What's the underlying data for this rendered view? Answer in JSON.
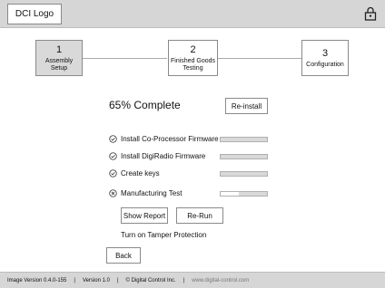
{
  "header": {
    "logo_label": "DCI Logo",
    "lock_icon": "lock-icon"
  },
  "steps": [
    {
      "number": "1",
      "label": "Assembly Setup",
      "active": true
    },
    {
      "number": "2",
      "label": "Finished Goods Testing",
      "active": false
    },
    {
      "number": "3",
      "label": "Configuration",
      "active": false
    }
  ],
  "progress": {
    "title": "65% Complete",
    "value_percent": 65,
    "reinstall_label": "Re-install"
  },
  "tasks": [
    {
      "label": "Install Co-Processor Firmware",
      "status": "done",
      "icon": "check-circle-icon",
      "progress": 0
    },
    {
      "label": "Install DigiRadio Firmware",
      "status": "done",
      "icon": "check-circle-icon",
      "progress": 0
    },
    {
      "label": "Create keys",
      "status": "done",
      "icon": "check-circle-icon",
      "progress": 0
    },
    {
      "label": "Manufacturing Test",
      "status": "failed",
      "icon": "x-circle-icon",
      "progress": 0.4
    }
  ],
  "actions": {
    "show_report_label": "Show Report",
    "rerun_label": "Re-Run",
    "tamper_text": "Turn on Tamper Protection",
    "back_label": "Back"
  },
  "footer": {
    "image_version": "Image Version 0.4.0-155",
    "separator": "|",
    "version": "Version 1.0",
    "copyright": "© Digital Control Inc.",
    "url": "www.digital-control.com"
  }
}
